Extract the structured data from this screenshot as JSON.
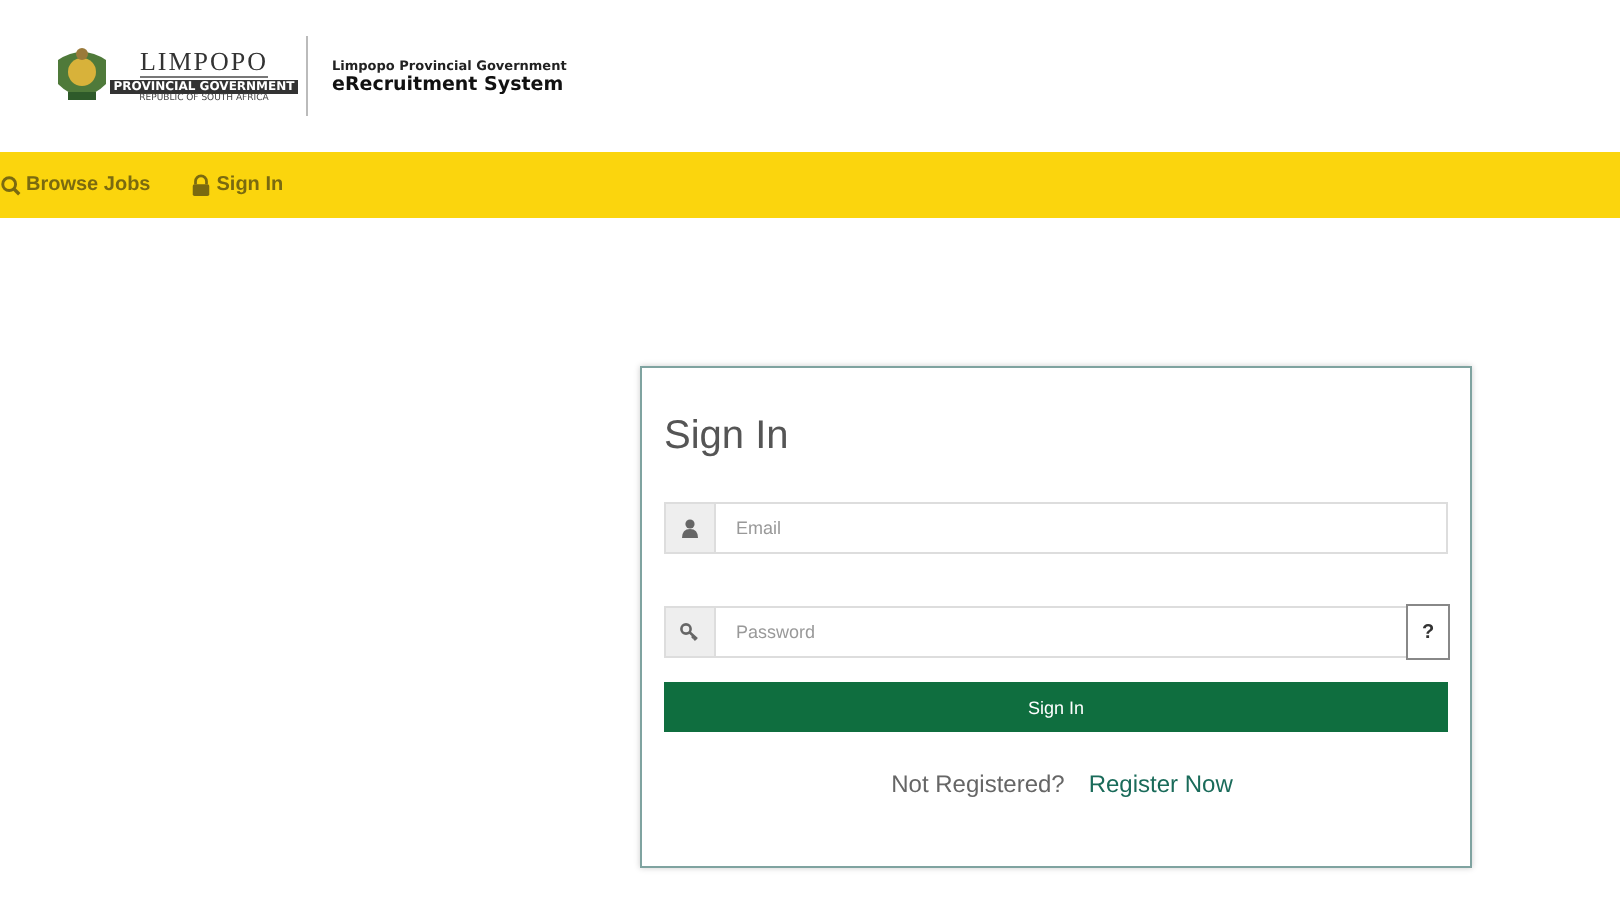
{
  "header": {
    "logo": {
      "name": "LIMPOPO",
      "line_1": "PROVINCIAL GOVERNMENT",
      "line_2": "REPUBLIC OF SOUTH AFRICA"
    },
    "subtitle": "Limpopo Provincial Government",
    "title": "eRecruitment System"
  },
  "nav": [
    {
      "label": "Browse Jobs"
    },
    {
      "label": "Sign In"
    }
  ],
  "sign_in": {
    "title": "Sign In",
    "email": {
      "placeholder": "Email"
    },
    "password": {
      "placeholder": "Password",
      "help": "?"
    },
    "button": "Sign In",
    "prompt": "Not Registered?",
    "register_link": "Register Now"
  }
}
